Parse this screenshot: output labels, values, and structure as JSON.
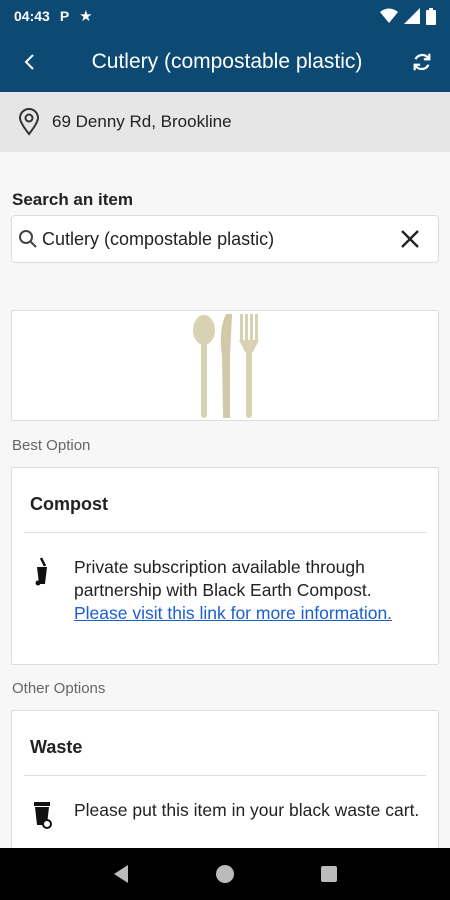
{
  "status_bar": {
    "time": "04:43",
    "p_glyph": "P"
  },
  "header": {
    "title": "Cutlery (compostable plastic)"
  },
  "location": {
    "address": "69 Denny Rd, Brookline"
  },
  "search": {
    "label": "Search an item",
    "value": "Cutlery (compostable plastic)"
  },
  "best_option": {
    "section_label": "Best Option",
    "title": "Compost",
    "description": "Private subscription available through partnership with Black Earth Compost. ",
    "link_text": "Please visit this link for more information."
  },
  "other_options": {
    "section_label": "Other Options",
    "title": "Waste",
    "description": "Please put this item in your black waste cart."
  },
  "icons": {
    "back": "back-arrow-icon",
    "refresh": "refresh-icon",
    "location": "location-pin-icon",
    "search": "search-icon",
    "clear": "close-icon",
    "compost": "compost-bin-icon",
    "waste": "waste-cart-icon"
  },
  "colors": {
    "primary": "#0d4a73",
    "link": "#1a5fd1"
  }
}
